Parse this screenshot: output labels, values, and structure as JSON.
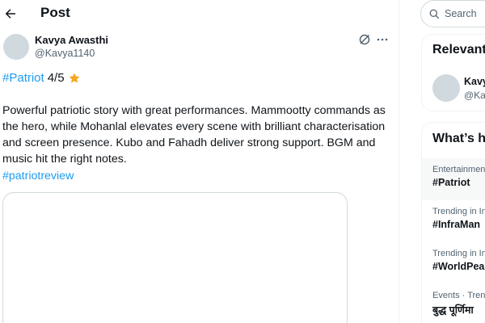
{
  "header": {
    "title": "Post",
    "back_icon": "arrow-left-icon"
  },
  "post": {
    "author_name": "Kavya Awasthi",
    "author_handle": "@Kavya1140",
    "hashtag": "#Patriot",
    "rating": "4/5",
    "body": "Powerful patriotic story with great performances. Mammootty commands as the hero, while Mohanlal elevates every scene with brilliant characterisation and screen presence. Kubo and Fahadh deliver strong support. BGM and music hit the right notes.",
    "review_hashtag": "#patriotreview",
    "icons": [
      "grok-icon",
      "more-icon",
      "star-icon"
    ]
  },
  "search": {
    "placeholder": "Search"
  },
  "relevant": {
    "heading": "Relevant",
    "person_name": "Kavy",
    "person_handle": "@Kavy"
  },
  "whats_happening": {
    "heading": "What’s h",
    "trends": [
      {
        "context": "Entertainment",
        "name": "#Patriot"
      },
      {
        "context": "Trending in In",
        "name": "#InfraMan"
      },
      {
        "context": "Trending in In",
        "name": "#WorldPea"
      },
      {
        "context": "Events · Trend",
        "name": "बुद्ध पूर्णिमा"
      }
    ]
  },
  "colors": {
    "link": "#1d9bf0",
    "muted": "#536471",
    "border": "#cfd9de",
    "star": "#f5a623"
  }
}
